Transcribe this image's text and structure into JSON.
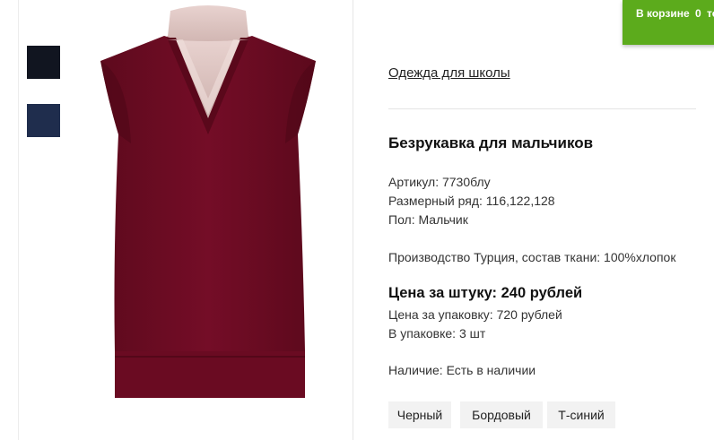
{
  "cart": {
    "prefix": "В корзине",
    "count": "0",
    "suffix": "то"
  },
  "breadcrumb": {
    "category": "Одежда для школы"
  },
  "product": {
    "title": "Безрукавка для мальчиков",
    "article": "Артикул: 7730блу",
    "size_range": "Размерный ряд: 116,122,128",
    "gender": "Пол: Мальчик",
    "origin": "Производство Турция, состав ткани: 100%хлопок",
    "price_per_item": "Цена за штуку: 240 рублей",
    "price_per_pack": "Цена за упаковку: 720 рублей",
    "pack_quantity": "В упаковке: 3 шт",
    "availability": "Наличие: Есть в наличии"
  },
  "colors": [
    "Черный",
    "Бордовый",
    "Т-синий"
  ],
  "thumbnail_colors": [
    "#111520",
    "#1f2d4d"
  ],
  "accent_color": "#5cab1c",
  "garment_color": "#6e0a22"
}
